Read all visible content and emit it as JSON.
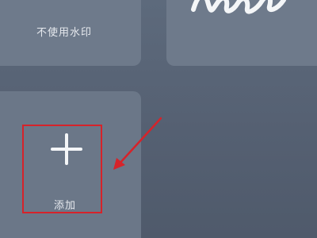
{
  "watermark_options": {
    "no_watermark": {
      "label": "不使用水印",
      "icon": "circle-icon"
    },
    "signature": {
      "icon": "handwritten-signature-icon"
    }
  },
  "add_tile": {
    "label": "添加",
    "icon": "plus-icon"
  },
  "annotation": {
    "color": "#d6232a",
    "icon": "arrow-icon"
  }
}
